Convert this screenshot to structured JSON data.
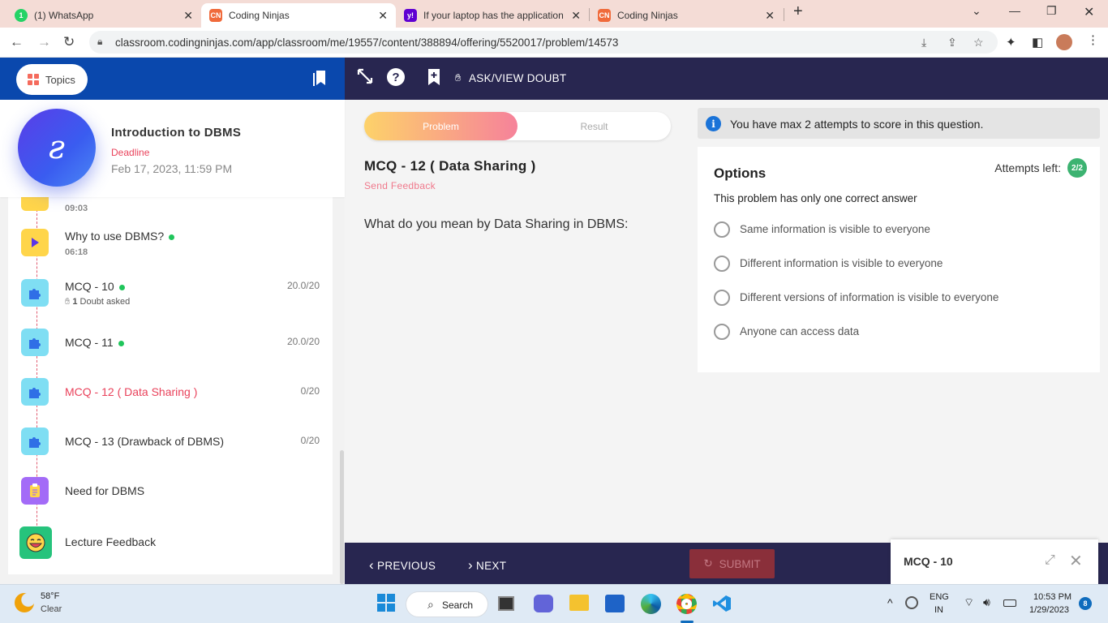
{
  "browser": {
    "tabs": [
      {
        "title": "(1) WhatsApp",
        "badge": "1",
        "icon": "whatsapp-icon"
      },
      {
        "title": "Coding Ninjas",
        "icon": "coding-ninjas-icon",
        "active": true
      },
      {
        "title": "If your laptop has the application",
        "icon": "yahoo-icon"
      },
      {
        "title": "Coding Ninjas",
        "icon": "coding-ninjas-icon"
      }
    ],
    "url": "classroom.codingninjas.com/app/classroom/me/19557/content/388894/offering/5520017/problem/14573"
  },
  "sidebar": {
    "topics_label": "Topics",
    "course_title": "Introduction to DBMS",
    "deadline_label": "Deadline",
    "deadline_date": "Feb 17, 2023, 11:59 PM",
    "items": [
      {
        "title": "",
        "sub": "09:03",
        "type": "video"
      },
      {
        "title": "Why to use DBMS?",
        "sub": "06:18",
        "type": "video",
        "done": true
      },
      {
        "title": "MCQ - 10",
        "doubt_count": "1",
        "doubt_text": "Doubt asked",
        "score": "20.0/20",
        "type": "puzzle",
        "done": true
      },
      {
        "title": "MCQ - 11",
        "score": "20.0/20",
        "type": "puzzle",
        "done": true
      },
      {
        "title": "MCQ - 12 ( Data Sharing )",
        "score": "0/20",
        "type": "puzzle",
        "current": true
      },
      {
        "title": "MCQ - 13 (Drawback of DBMS)",
        "score": "0/20",
        "type": "puzzle"
      },
      {
        "title": "Need for DBMS",
        "type": "note"
      },
      {
        "title": "Lecture Feedback",
        "type": "smile"
      }
    ]
  },
  "toolbar": {
    "ask_label": "ASK/VIEW DOUBT"
  },
  "problem": {
    "tab_problem": "Problem",
    "tab_result": "Result",
    "title": "MCQ - 12 ( Data Sharing )",
    "feedback_label": "Send Feedback",
    "question": "What do you mean by Data Sharing in DBMS:"
  },
  "options_panel": {
    "info_text": "You have max 2 attempts to score in this question.",
    "heading": "Options",
    "attempts_label": "Attempts left:",
    "attempts_value": "2/2",
    "subheading": "This problem has only one correct answer",
    "options": [
      "Same information is visible to everyone",
      "Different information is visible to everyone",
      "Different versions of information is visible to everyone",
      "Anyone can access data"
    ]
  },
  "footer": {
    "previous_label": "PREVIOUS",
    "next_label": "NEXT",
    "submit_label": "SUBMIT",
    "popup_title": "MCQ - 10"
  },
  "taskbar": {
    "temperature": "58°F",
    "condition": "Clear",
    "search_label": "Search",
    "lang_top": "ENG",
    "lang_bottom": "IN",
    "time": "10:53 PM",
    "date": "1/29/2023",
    "notifications": "8"
  },
  "colors": {
    "header_blue": "#0a48ad",
    "dark_bar": "#282650",
    "accent_pink": "#e9425b",
    "done_green": "#20c55b"
  }
}
